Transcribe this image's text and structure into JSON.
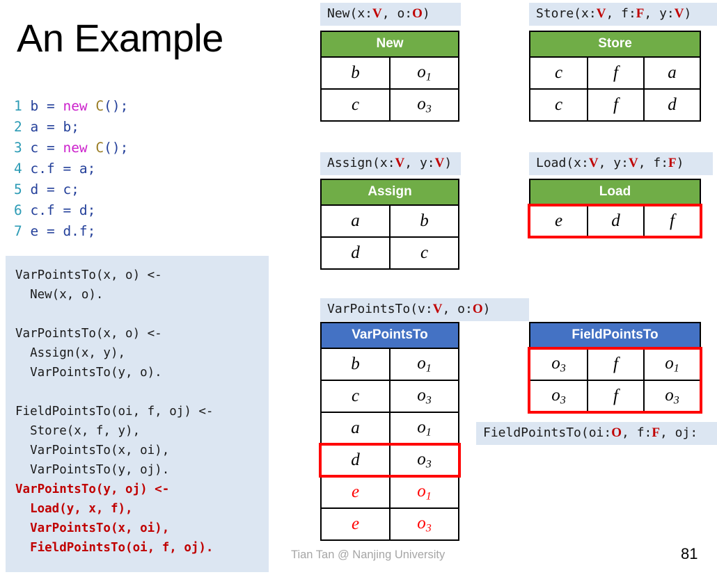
{
  "slide": {
    "title": "An Example",
    "footer_author": "Tian Tan @ Nanjing University",
    "page_number": "81"
  },
  "colors": {
    "header_green": "#70AD47",
    "header_blue": "#4472C4",
    "signature_bg": "#DCE6F2",
    "rules_bg": "#DCE6F2",
    "highlight_red": "#FF0000",
    "rule_red_text": "#C00000",
    "footer_gray": "#A6A6A6"
  },
  "code": {
    "lines": [
      {
        "num": "1",
        "tokens": [
          {
            "t": "b = ",
            "c": "id"
          },
          {
            "t": "new ",
            "c": "kw"
          },
          {
            "t": "C",
            "c": "cls"
          },
          {
            "t": "();",
            "c": "pl"
          }
        ]
      },
      {
        "num": "2",
        "tokens": [
          {
            "t": "a = b;",
            "c": "id"
          }
        ]
      },
      {
        "num": "3",
        "tokens": [
          {
            "t": "c = ",
            "c": "id"
          },
          {
            "t": "new ",
            "c": "kw"
          },
          {
            "t": "C",
            "c": "cls"
          },
          {
            "t": "();",
            "c": "pl"
          }
        ]
      },
      {
        "num": "4",
        "tokens": [
          {
            "t": "c.f = a;",
            "c": "id"
          }
        ]
      },
      {
        "num": "5",
        "tokens": [
          {
            "t": "d = c;",
            "c": "id"
          }
        ]
      },
      {
        "num": "6",
        "tokens": [
          {
            "t": "c.f = d;",
            "c": "id"
          }
        ]
      },
      {
        "num": "7",
        "tokens": [
          {
            "t": "e = d.f;",
            "c": "id"
          }
        ]
      }
    ],
    "plain_text": "1 b = new C();\n2 a = b;\n3 c = new C();\n4 c.f = a;\n5 d = c;\n6 c.f = d;\n7 e = d.f;"
  },
  "rules": {
    "black_block": "VarPointsTo(x, o) <-\n  New(x, o).\n\nVarPointsTo(x, o) <-\n  Assign(x, y),\n  VarPointsTo(y, o).\n\nFieldPointsTo(oi, f, oj) <-\n  Store(x, f, y),\n  VarPointsTo(x, oi),\n  VarPointsTo(y, oj).\n",
    "red_block": "VarPointsTo(y, oj) <-\n  Load(y, x, f),\n  VarPointsTo(x, oi),\n  FieldPointsTo(oi, f, oj)."
  },
  "relations": {
    "new": {
      "signature_parts": [
        {
          "t": "New(x:",
          "red": false
        },
        {
          "t": "V",
          "red": true
        },
        {
          "t": ", o:",
          "red": false
        },
        {
          "t": "O",
          "red": true
        },
        {
          "t": ")",
          "red": false
        }
      ],
      "signature_text": "New(x:V, o:O)",
      "header": "New",
      "header_color": "green",
      "columns": 2,
      "rows": [
        [
          {
            "v": "b",
            "sub": "",
            "red": false
          },
          {
            "v": "o",
            "sub": "1",
            "red": false
          }
        ],
        [
          {
            "v": "c",
            "sub": "",
            "red": false
          },
          {
            "v": "o",
            "sub": "3",
            "red": false
          }
        ]
      ],
      "highlighted_rows": []
    },
    "store": {
      "signature_parts": [
        {
          "t": "Store(x:",
          "red": false
        },
        {
          "t": "V",
          "red": true
        },
        {
          "t": ", f:",
          "red": false
        },
        {
          "t": "F",
          "red": true
        },
        {
          "t": ", y:",
          "red": false
        },
        {
          "t": "V",
          "red": true
        },
        {
          "t": ")",
          "red": false
        }
      ],
      "signature_text": "Store(x:V, f:F, y:V)",
      "header": "Store",
      "header_color": "green",
      "columns": 3,
      "rows": [
        [
          {
            "v": "c",
            "sub": "",
            "red": false
          },
          {
            "v": "f",
            "sub": "",
            "red": false
          },
          {
            "v": "a",
            "sub": "",
            "red": false
          }
        ],
        [
          {
            "v": "c",
            "sub": "",
            "red": false
          },
          {
            "v": "f",
            "sub": "",
            "red": false
          },
          {
            "v": "d",
            "sub": "",
            "red": false
          }
        ]
      ],
      "highlighted_rows": []
    },
    "assign": {
      "signature_parts": [
        {
          "t": "Assign(x:",
          "red": false
        },
        {
          "t": "V",
          "red": true
        },
        {
          "t": ", y:",
          "red": false
        },
        {
          "t": "V",
          "red": true
        },
        {
          "t": ")",
          "red": false
        }
      ],
      "signature_text": "Assign(x:V, y:V)",
      "header": "Assign",
      "header_color": "green",
      "columns": 2,
      "rows": [
        [
          {
            "v": "a",
            "sub": "",
            "red": false
          },
          {
            "v": "b",
            "sub": "",
            "red": false
          }
        ],
        [
          {
            "v": "d",
            "sub": "",
            "red": false
          },
          {
            "v": "c",
            "sub": "",
            "red": false
          }
        ]
      ],
      "highlighted_rows": []
    },
    "load": {
      "signature_parts": [
        {
          "t": "Load(x:",
          "red": false
        },
        {
          "t": "V",
          "red": true
        },
        {
          "t": ", y:",
          "red": false
        },
        {
          "t": "V",
          "red": true
        },
        {
          "t": ", f:",
          "red": false
        },
        {
          "t": "F",
          "red": true
        },
        {
          "t": ")",
          "red": false
        }
      ],
      "signature_text": "Load(x:V, y:V, f:F)",
      "header": "Load",
      "header_color": "green",
      "columns": 3,
      "rows": [
        [
          {
            "v": "e",
            "sub": "",
            "red": false
          },
          {
            "v": "d",
            "sub": "",
            "red": false
          },
          {
            "v": "f",
            "sub": "",
            "red": false
          }
        ]
      ],
      "highlighted_rows": [
        0
      ]
    },
    "varpointsto": {
      "signature_parts": [
        {
          "t": "VarPointsTo(v:",
          "red": false
        },
        {
          "t": "V",
          "red": true
        },
        {
          "t": ", o:",
          "red": false
        },
        {
          "t": "O",
          "red": true
        },
        {
          "t": ")",
          "red": false
        }
      ],
      "signature_text": "VarPointsTo(v:V, o:O)",
      "header": "VarPointsTo",
      "header_color": "blue",
      "columns": 2,
      "rows": [
        [
          {
            "v": "b",
            "sub": "",
            "red": false
          },
          {
            "v": "o",
            "sub": "1",
            "red": false
          }
        ],
        [
          {
            "v": "c",
            "sub": "",
            "red": false
          },
          {
            "v": "o",
            "sub": "3",
            "red": false
          }
        ],
        [
          {
            "v": "a",
            "sub": "",
            "red": false
          },
          {
            "v": "o",
            "sub": "1",
            "red": false
          }
        ],
        [
          {
            "v": "d",
            "sub": "",
            "red": false
          },
          {
            "v": "o",
            "sub": "3",
            "red": false
          }
        ],
        [
          {
            "v": "e",
            "sub": "",
            "red": true
          },
          {
            "v": "o",
            "sub": "1",
            "red": true
          }
        ],
        [
          {
            "v": "e",
            "sub": "",
            "red": true
          },
          {
            "v": "o",
            "sub": "3",
            "red": true
          }
        ]
      ],
      "highlighted_rows": [
        3
      ]
    },
    "fieldpointsto": {
      "signature_parts": [
        {
          "t": "FieldPointsTo(oi:",
          "red": false
        },
        {
          "t": "O",
          "red": true
        },
        {
          "t": ", f:",
          "red": false
        },
        {
          "t": "F",
          "red": true
        },
        {
          "t": ", oj:",
          "red": false
        }
      ],
      "signature_text": "FieldPointsTo(oi:O, f:F, oj:",
      "header": "FieldPointsTo",
      "header_color": "blue",
      "columns": 3,
      "rows": [
        [
          {
            "v": "o",
            "sub": "3",
            "red": false
          },
          {
            "v": "f",
            "sub": "",
            "red": false
          },
          {
            "v": "o",
            "sub": "1",
            "red": false
          }
        ],
        [
          {
            "v": "o",
            "sub": "3",
            "red": false
          },
          {
            "v": "f",
            "sub": "",
            "red": false
          },
          {
            "v": "o",
            "sub": "3",
            "red": false
          }
        ]
      ],
      "highlighted_rows": [
        0,
        1
      ]
    }
  }
}
